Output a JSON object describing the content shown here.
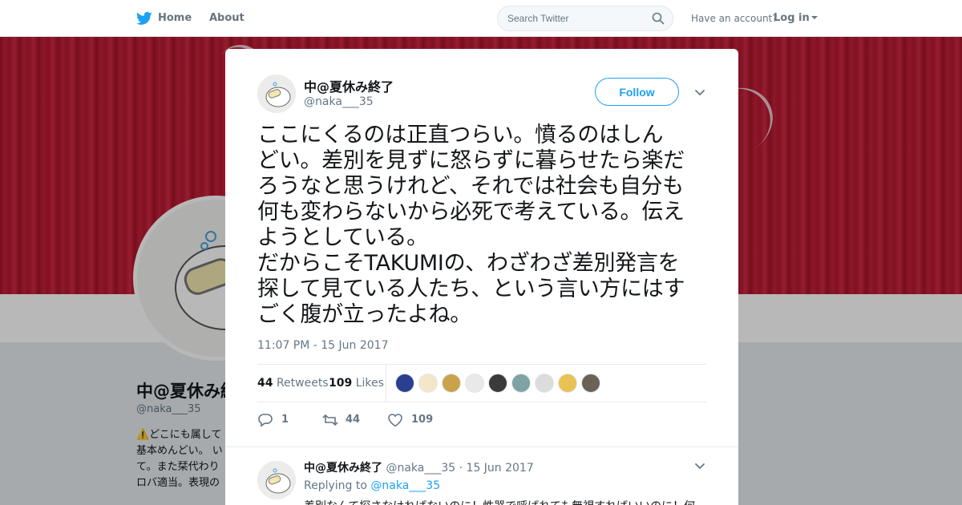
{
  "nav": {
    "home_label": "Home",
    "about_label": "About",
    "search_placeholder": "Search Twitter",
    "have_account": "Have an account?",
    "login_label": "Log in"
  },
  "profile": {
    "name": "中@夏休み終了",
    "handle": "@naka___35",
    "bio_lines": [
      "⚠️どこにも属して",
      "基本めんどい。 い",
      "て。また栞代わり",
      "ロバ適当。表現の"
    ]
  },
  "tweet": {
    "author_name": "中@夏休み終了",
    "author_handle": "@naka___35",
    "follow_label": "Follow",
    "text_lines": [
      "ここにくるのは正直つらい。憤るのはしん",
      "どい。差別を見ずに怒らずに暮らせたら楽だ",
      "ろうなと思うけれど、それでは社会も自分も",
      "何も変わらないから必死で考えている。伝え",
      "ようとしている。",
      "だからこそTAKUMIの、わざわざ差別発言を",
      "探して見ている人たち、という言い方にはす",
      "ごく腹が立ったよね。"
    ],
    "timestamp": "11:07 PM - 15 Jun 2017",
    "retweets_count": "44",
    "retweets_label": "Retweets",
    "likes_count": "109",
    "likes_label": "Likes",
    "liker_colors": [
      "#2a3f8f",
      "#f3e6c9",
      "#c9a24a",
      "#e9e9e9",
      "#3b3b3b",
      "#7fa3a3",
      "#dcdcdc",
      "#e8c254",
      "#6b6255"
    ],
    "reply_count": "1",
    "retweet_count": "44",
    "like_count": "109"
  },
  "reply": {
    "author_name": "中@夏休み終了",
    "author_handle": "@naka___35",
    "separator": "·",
    "date": "15 Jun 2017",
    "replying_to_label": "Replying to",
    "replying_to_handle": "@naka___35",
    "text": "差別なんて探さなければないのに！性器で呼ばれても無視すればいいのに！何"
  },
  "colors": {
    "accent": "#1da1f2",
    "banner": "#c4213a"
  }
}
